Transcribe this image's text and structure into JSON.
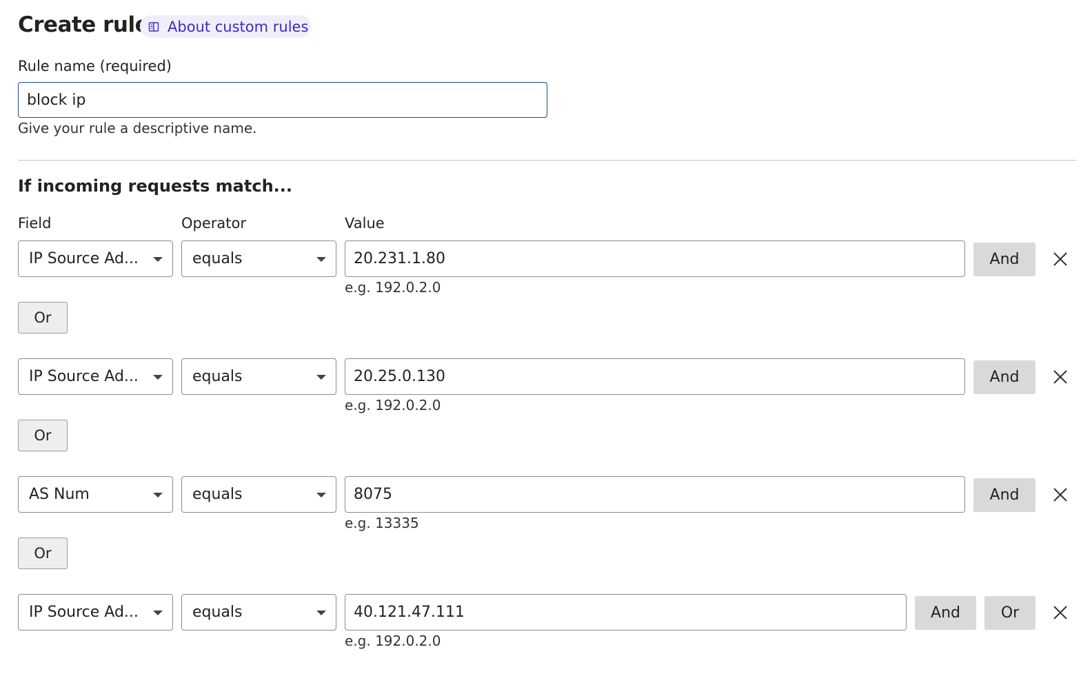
{
  "header": {
    "title": "Create rule",
    "doc_link": "About custom rules"
  },
  "rule_name": {
    "label": "Rule name (required)",
    "value": "block ip",
    "hint": "Give your rule a descriptive name."
  },
  "match": {
    "title": "If incoming requests match...",
    "col_field": "Field",
    "col_operator": "Operator",
    "col_value": "Value",
    "conditions": [
      {
        "field": "IP Source Ad...",
        "operator": "equals",
        "value": "20.231.1.80",
        "example": "e.g. 192.0.2.0"
      },
      {
        "field": "IP Source Ad...",
        "operator": "equals",
        "value": "20.25.0.130",
        "example": "e.g. 192.0.2.0"
      },
      {
        "field": "AS Num",
        "operator": "equals",
        "value": "8075",
        "example": "e.g. 13335"
      },
      {
        "field": "IP Source Ad...",
        "operator": "equals",
        "value": "40.121.47.111",
        "example": "e.g. 192.0.2.0"
      }
    ],
    "and_label": "And",
    "or_label": "Or"
  },
  "icons": {
    "doc": "book-icon",
    "dropdown": "caret-down-icon",
    "remove": "close-icon"
  }
}
